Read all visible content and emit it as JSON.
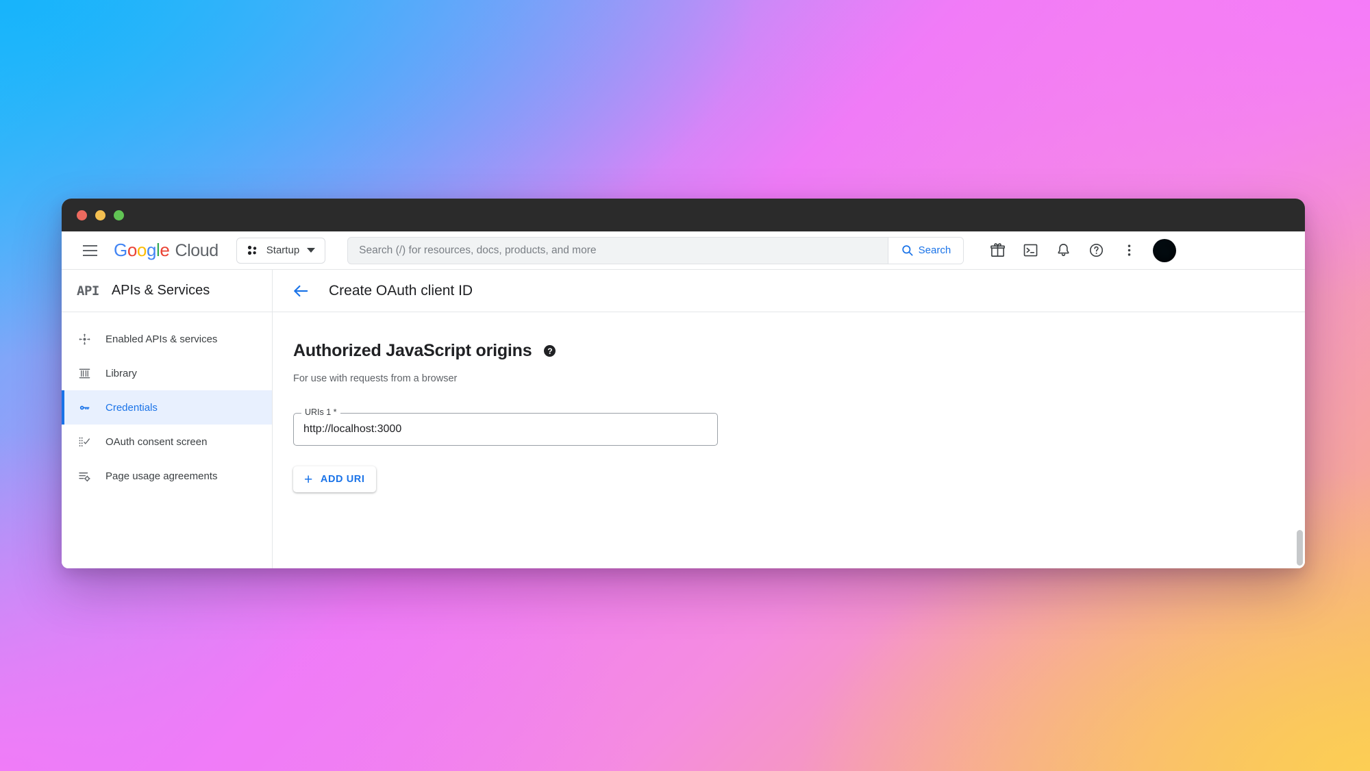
{
  "window": {
    "traffic_lights": [
      "close",
      "minimize",
      "zoom"
    ]
  },
  "header": {
    "menu_icon": "hamburger-icon",
    "brand": {
      "g": "G",
      "o1": "o",
      "o2": "o",
      "g2": "g",
      "l": "l",
      "e": "e",
      "cloud": "Cloud"
    },
    "project": {
      "label": "Startup",
      "icon": "project-dots-icon",
      "caret": "chevron-down-icon"
    },
    "search": {
      "placeholder": "Search (/) for resources, docs, products, and more",
      "value": "",
      "button_label": "Search",
      "icon": "search-icon"
    },
    "icons": [
      {
        "name": "gift-icon",
        "title": "Free trial credits"
      },
      {
        "name": "cloud-shell-icon",
        "title": "Activate Cloud Shell"
      },
      {
        "name": "bell-icon",
        "title": "Notifications"
      },
      {
        "name": "help-circle-icon",
        "title": "Support"
      },
      {
        "name": "more-vert-icon",
        "title": "More options"
      }
    ],
    "avatar": "user-avatar"
  },
  "sidebar": {
    "logo_text": "API",
    "title": "APIs & Services",
    "items": [
      {
        "label": "Enabled APIs & services",
        "icon": "dashboard-api-icon",
        "selected": false
      },
      {
        "label": "Library",
        "icon": "library-icon",
        "selected": false
      },
      {
        "label": "Credentials",
        "icon": "key-icon",
        "selected": true
      },
      {
        "label": "OAuth consent screen",
        "icon": "consent-screen-icon",
        "selected": false
      },
      {
        "label": "Page usage agreements",
        "icon": "page-agreements-icon",
        "selected": false
      }
    ]
  },
  "main": {
    "back_icon": "arrow-back-icon",
    "title": "Create OAuth client ID",
    "section": {
      "heading": "Authorized JavaScript origins",
      "help_icon": "help-filled-icon",
      "help_glyph": "?",
      "subtitle": "For use with requests from a browser"
    },
    "uri_field": {
      "legend": "URIs 1 *",
      "value": "http://localhost:3000",
      "placeholder": ""
    },
    "add_uri": {
      "plus": "+",
      "label": "ADD URI"
    }
  },
  "colors": {
    "accent_blue": "#1a73e8",
    "selected_bg": "#e8f0fe",
    "titlebar": "#2b2b2b",
    "text_primary": "#202124",
    "text_secondary": "#5f6368"
  }
}
